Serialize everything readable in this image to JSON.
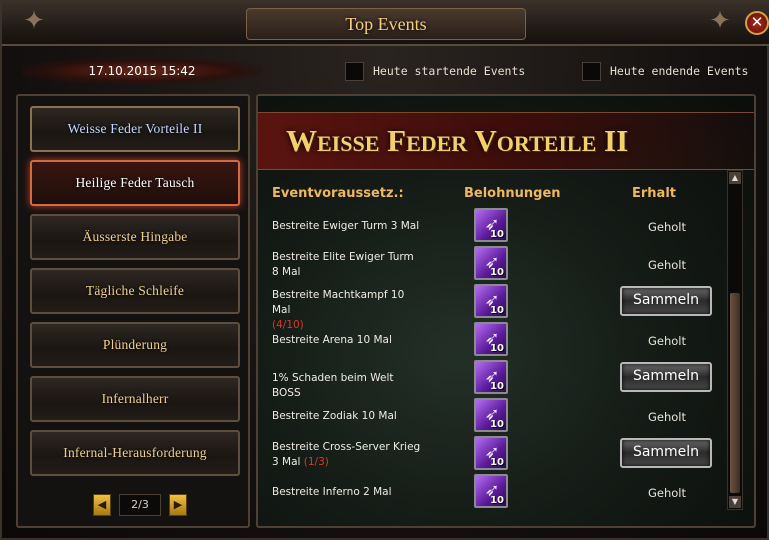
{
  "window": {
    "title": "Top Events",
    "close": "✕"
  },
  "datetime": "17.10.2015 15:42",
  "filters": [
    {
      "label": "Heute startende Events",
      "checked": false
    },
    {
      "label": "Heute endende Events",
      "checked": false
    }
  ],
  "events": [
    {
      "label": "Weisse Feder Vorteile II",
      "state": "active"
    },
    {
      "label": "Heilige Feder Tausch",
      "state": "hover"
    },
    {
      "label": "Äusserste Hingabe",
      "state": "normal"
    },
    {
      "label": "Tägliche Schleife",
      "state": "normal"
    },
    {
      "label": "Plünderung",
      "state": "normal"
    },
    {
      "label": "Infernalherr",
      "state": "normal"
    },
    {
      "label": "Infernal-Herausforderung",
      "state": "normal"
    }
  ],
  "pager": {
    "prev": "◀",
    "page": "2/3",
    "next": "▶"
  },
  "detail": {
    "title": "Weisse Feder Vorteile II",
    "columns": {
      "requirement": "Eventvoraussetz.:",
      "reward": "Belohnungen",
      "status": "Erhalt"
    },
    "rows": [
      {
        "req": "Bestreite Ewiger Turm 3 Mal",
        "progress": "",
        "qty": "10",
        "status": "Geholt",
        "action": ""
      },
      {
        "req": "Bestreite Elite Ewiger Turm 8 Mal",
        "progress": "",
        "qty": "10",
        "status": "Geholt",
        "action": ""
      },
      {
        "req": "Bestreite Machtkampf 10 Mal",
        "progress": "(4/10)",
        "qty": "10",
        "status": "",
        "action": "Sammeln"
      },
      {
        "req": "Bestreite Arena 10 Mal",
        "progress": "",
        "qty": "10",
        "status": "Geholt",
        "action": ""
      },
      {
        "req": "1% Schaden beim Welt BOSS",
        "progress": "",
        "qty": "10",
        "status": "",
        "action": "Sammeln"
      },
      {
        "req": "Bestreite Zodiak 10 Mal",
        "progress": "",
        "qty": "10",
        "status": "Geholt",
        "action": ""
      },
      {
        "req": "Bestreite Cross-Server Krieg 3 Mal",
        "progress": "(1/3)",
        "qty": "10",
        "status": "",
        "action": "Sammeln"
      },
      {
        "req": "Bestreite Inferno 2 Mal",
        "progress": "",
        "qty": "10",
        "status": "Geholt",
        "action": ""
      }
    ]
  },
  "colors": {
    "gold": "#f0d188",
    "accent_red": "#d43a2a",
    "active_blue": "#c4d8ff"
  },
  "icons": {
    "feather": "white-feather-icon",
    "close": "close-icon",
    "prev": "arrow-left-icon",
    "next": "arrow-right-icon"
  }
}
